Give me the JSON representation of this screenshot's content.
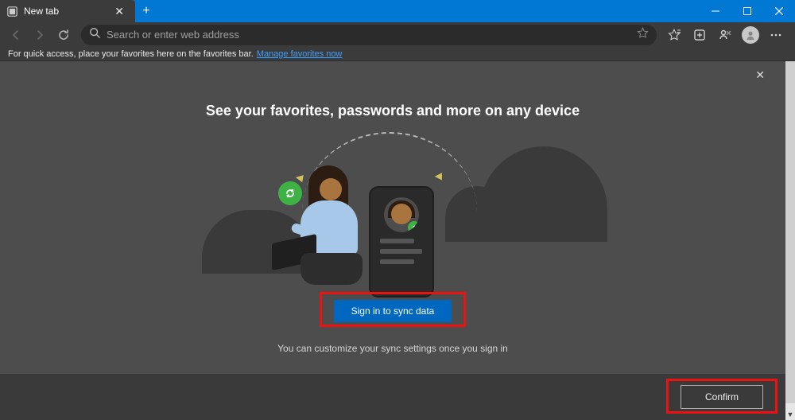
{
  "window": {
    "tab_title": "New tab",
    "controls": {
      "min": "—",
      "max": "▢",
      "close": "✕"
    }
  },
  "toolbar": {
    "search_placeholder": "Search or enter web address"
  },
  "favorites_bar": {
    "hint": "For quick access, place your favorites here on the favorites bar.",
    "link_text": "Manage favorites now"
  },
  "sync_panel": {
    "title": "See your favorites, passwords and more on any device",
    "signin_label": "Sign in to sync data",
    "hint": "You can customize your sync settings once you sign in",
    "confirm_label": "Confirm"
  },
  "colors": {
    "accent": "#0078d4",
    "highlight": "#e11"
  }
}
